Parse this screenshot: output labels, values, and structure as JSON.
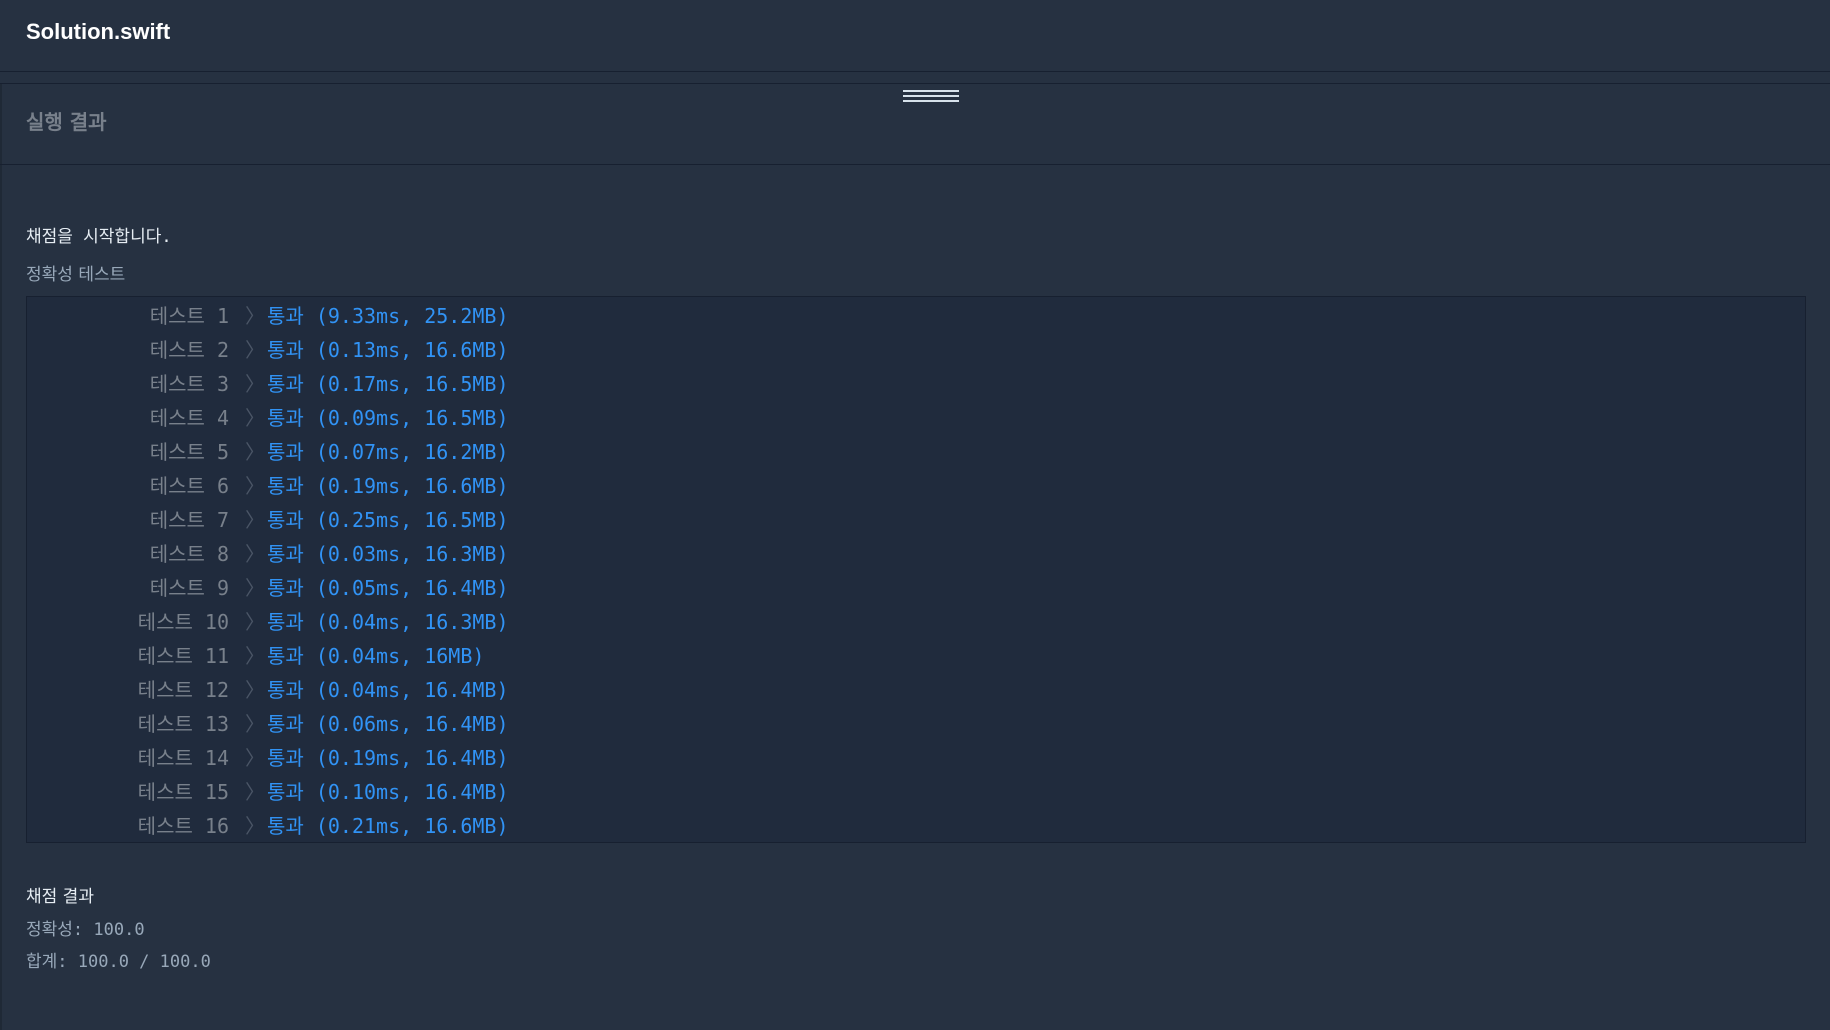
{
  "editor": {
    "file_title": "Solution.swift"
  },
  "panel": {
    "title": "실행 결과"
  },
  "console": {
    "start_message": "채점을 시작합니다.",
    "section_label": "정확성  테스트",
    "chevron_glyph": "〉",
    "tests": [
      {
        "label": "테스트 1",
        "result": "통과 (9.33ms, 25.2MB)"
      },
      {
        "label": "테스트 2",
        "result": "통과 (0.13ms, 16.6MB)"
      },
      {
        "label": "테스트 3",
        "result": "통과 (0.17ms, 16.5MB)"
      },
      {
        "label": "테스트 4",
        "result": "통과 (0.09ms, 16.5MB)"
      },
      {
        "label": "테스트 5",
        "result": "통과 (0.07ms, 16.2MB)"
      },
      {
        "label": "테스트 6",
        "result": "통과 (0.19ms, 16.6MB)"
      },
      {
        "label": "테스트 7",
        "result": "통과 (0.25ms, 16.5MB)"
      },
      {
        "label": "테스트 8",
        "result": "통과 (0.03ms, 16.3MB)"
      },
      {
        "label": "테스트 9",
        "result": "통과 (0.05ms, 16.4MB)"
      },
      {
        "label": "테스트 10",
        "result": "통과 (0.04ms, 16.3MB)"
      },
      {
        "label": "테스트 11",
        "result": "통과 (0.04ms, 16MB)"
      },
      {
        "label": "테스트 12",
        "result": "통과 (0.04ms, 16.4MB)"
      },
      {
        "label": "테스트 13",
        "result": "통과 (0.06ms, 16.4MB)"
      },
      {
        "label": "테스트 14",
        "result": "통과 (0.19ms, 16.4MB)"
      },
      {
        "label": "테스트 15",
        "result": "통과 (0.10ms, 16.4MB)"
      },
      {
        "label": "테스트 16",
        "result": "통과 (0.21ms, 16.6MB)"
      }
    ],
    "result_title": "채점 결과",
    "accuracy_line": "정확성: 100.0",
    "total_line": "합계: 100.0 / 100.0"
  },
  "colors": {
    "background": "#263141",
    "test_box": "#202b3d",
    "pass": "#3193f5",
    "muted": "#78808b"
  }
}
